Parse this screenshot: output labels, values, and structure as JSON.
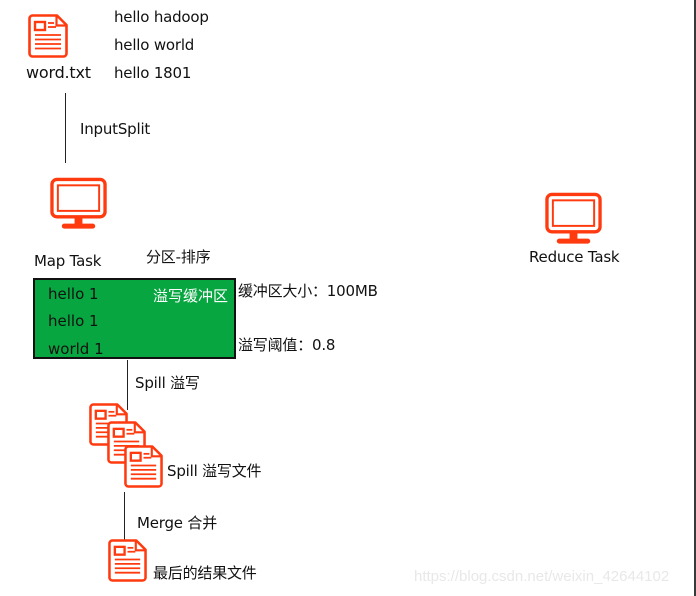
{
  "input_file": {
    "icon": "text-document-icon",
    "name": "word.txt",
    "lines": [
      "hello hadoop",
      "hello world",
      "hello 1801"
    ]
  },
  "input_split": {
    "label": "InputSplit"
  },
  "map_task": {
    "icon": "monitor-icon",
    "label": "Map Task",
    "partition_sort_label": "分区-排序"
  },
  "reduce_task": {
    "icon": "monitor-icon",
    "label": "Reduce Task"
  },
  "spill_buffer": {
    "title": "溢写缓冲区",
    "rows": [
      "hello  1",
      "hello 1",
      "world  1"
    ],
    "size_label": "缓冲区大小：100MB",
    "threshold_label": "溢写阈值：0.8",
    "fill_color": "#08a640"
  },
  "spill": {
    "label": "Spill  溢写"
  },
  "spill_files": {
    "icon": "text-document-icon",
    "count": 3,
    "label": "Spill 溢写文件"
  },
  "merge": {
    "label": "Merge 合并"
  },
  "final_file": {
    "icon": "text-document-icon",
    "label": "最后的结果文件"
  },
  "watermark": "https://blog.csdn.net/weixin_42644102",
  "colors": {
    "icon": "#ff3a0f",
    "line": "#222222",
    "text": "#111111"
  }
}
